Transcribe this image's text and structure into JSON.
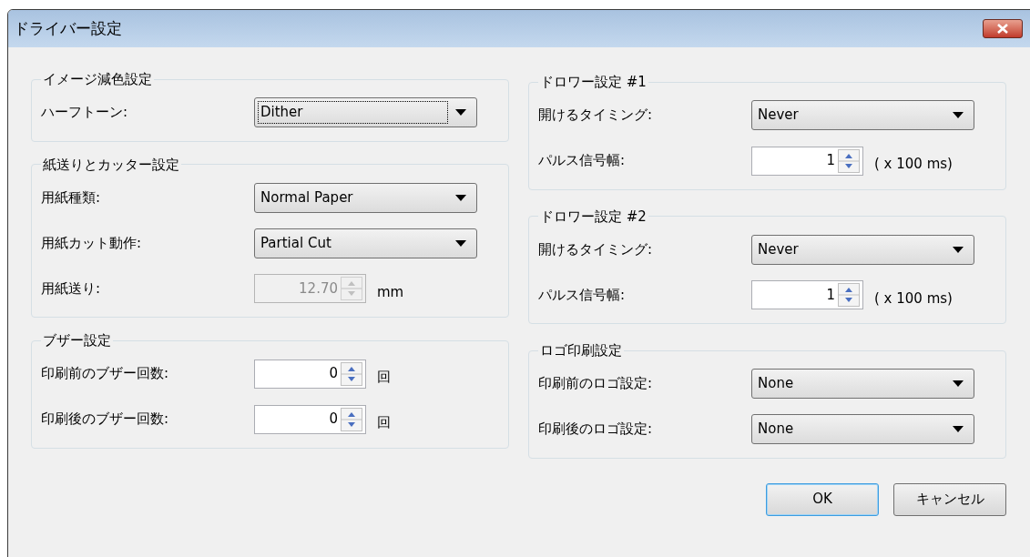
{
  "window": {
    "title": "ドライバー設定"
  },
  "columns": [
    [
      {
        "title": "イメージ減色設定",
        "rows": [
          {
            "kind": "dropdown",
            "label": "ハーフトーン:",
            "value": "Dither",
            "focused": true
          }
        ]
      },
      {
        "title": "紙送りとカッター設定",
        "rows": [
          {
            "kind": "dropdown",
            "label": "用紙種類:",
            "value": "Normal Paper",
            "focused": false
          },
          {
            "kind": "dropdown",
            "label": "用紙カット動作:",
            "value": "Partial Cut",
            "focused": false
          },
          {
            "kind": "spin",
            "label": "用紙送り:",
            "value": "12.70",
            "unit": "mm",
            "disabled": true
          }
        ]
      },
      {
        "title": "ブザー設定",
        "rows": [
          {
            "kind": "spin",
            "label": "印刷前のブザー回数:",
            "value": "0",
            "unit": "回",
            "disabled": false
          },
          {
            "kind": "spin",
            "label": "印刷後のブザー回数:",
            "value": "0",
            "unit": "回",
            "disabled": false
          }
        ]
      }
    ],
    [
      {
        "title": "ドロワー設定 #1",
        "rows": [
          {
            "kind": "dropdown",
            "label": "開けるタイミング:",
            "value": "Never",
            "focused": false
          },
          {
            "kind": "spin",
            "label": "パルス信号幅:",
            "value": "1",
            "unit": "( x 100 ms)",
            "disabled": false
          }
        ]
      },
      {
        "title": "ドロワー設定 #2",
        "rows": [
          {
            "kind": "dropdown",
            "label": "開けるタイミング:",
            "value": "Never",
            "focused": false
          },
          {
            "kind": "spin",
            "label": "パルス信号幅:",
            "value": "1",
            "unit": "( x 100 ms)",
            "disabled": false
          }
        ]
      },
      {
        "title": "ロゴ印刷設定",
        "rows": [
          {
            "kind": "dropdown",
            "label": "印刷前のロゴ設定:",
            "value": "None",
            "focused": false
          },
          {
            "kind": "dropdown",
            "label": "印刷後のロゴ設定:",
            "value": "None",
            "focused": false
          }
        ]
      }
    ]
  ],
  "buttons": [
    {
      "label": "OK",
      "default": true
    },
    {
      "label": "キャンセル",
      "default": false
    }
  ]
}
